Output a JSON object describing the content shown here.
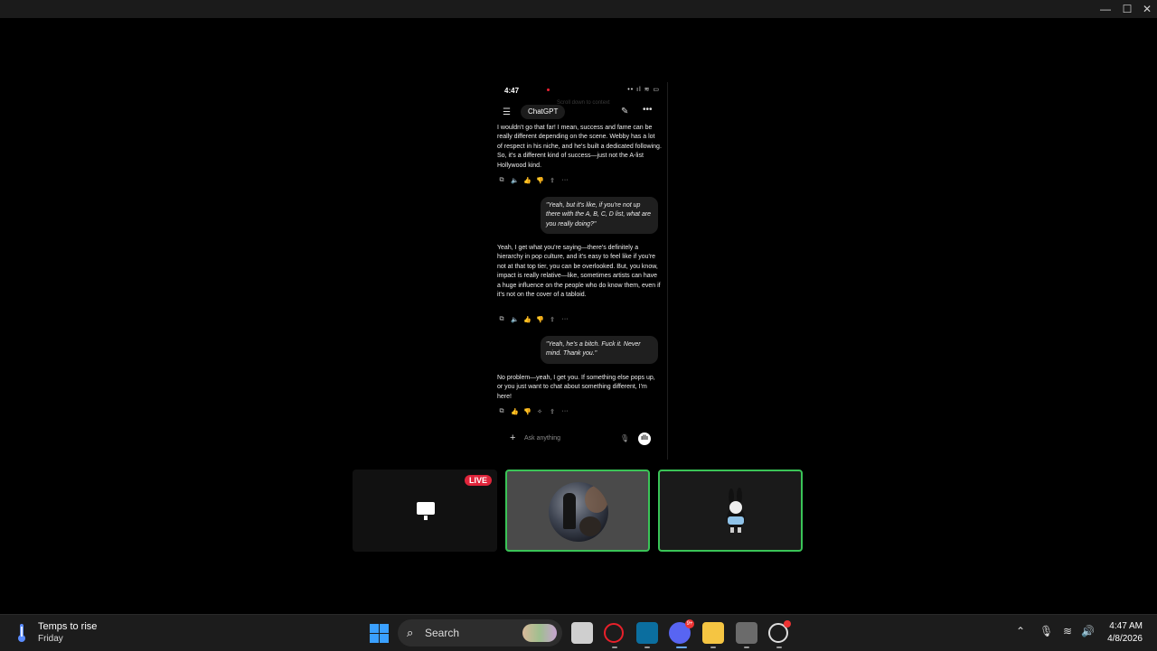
{
  "window": {
    "minimize": "—",
    "maximize": "☐",
    "close": "✕"
  },
  "phone": {
    "status_time": "4:47",
    "status_right": "•• ıl ≋ ▭",
    "ghost_text": "Scroll down to context",
    "app_title": "ChatGPT",
    "menu_icon": "☰",
    "edit_icon": "✎",
    "more_icon": "•••",
    "messages": [
      {
        "role": "assistant",
        "text": "I wouldn't go that far! I mean, success and fame can be really different depending on the scene. Webby has a lot of respect in his niche, and he's built a dedicated following. So, it's a different kind of success—just not the A-list Hollywood kind."
      },
      {
        "role": "user",
        "text": "\"Yeah, but it's like, if you're not up there with the A, B, C, D list, what are you really doing?\""
      },
      {
        "role": "assistant",
        "text": "Yeah, I get what you're saying—there's definitely a hierarchy in pop culture, and it's easy to feel like if you're not at that top tier, you can be overlooked. But, you know, impact is really relative—like, sometimes artists can have a huge influence on the people who do know them, even if it's not on the cover of a tabloid."
      },
      {
        "role": "user",
        "text": "\"Yeah, he's a bitch. Fuck it. Never mind. Thank you.\""
      },
      {
        "role": "assistant",
        "text": "No problem—yeah, I get you. If something else pops up, or you just want to chat about something different, I'm here!"
      }
    ],
    "action_icons": [
      "⧉",
      "🔈",
      "👍",
      "👎",
      "⇪",
      "···"
    ],
    "action_icons_last": [
      "⧉",
      "👍",
      "👎",
      "✧",
      "⇪",
      "···"
    ],
    "input_placeholder": "Ask anything",
    "plus_icon": "+",
    "mic_icon": "🎙",
    "voice_icon": "ıllı"
  },
  "tiles": {
    "live_label": "LIVE"
  },
  "taskbar": {
    "weather_line1": "Temps to rise",
    "weather_line2": "Friday",
    "search_label": "Search",
    "discord_badge": "9+",
    "clock_time": "4:47 AM",
    "clock_date": "4/8/2026",
    "tray_chevron": "⌃",
    "tray_mic": "🎙",
    "tray_wifi": "≋",
    "tray_volume": "🔊"
  }
}
